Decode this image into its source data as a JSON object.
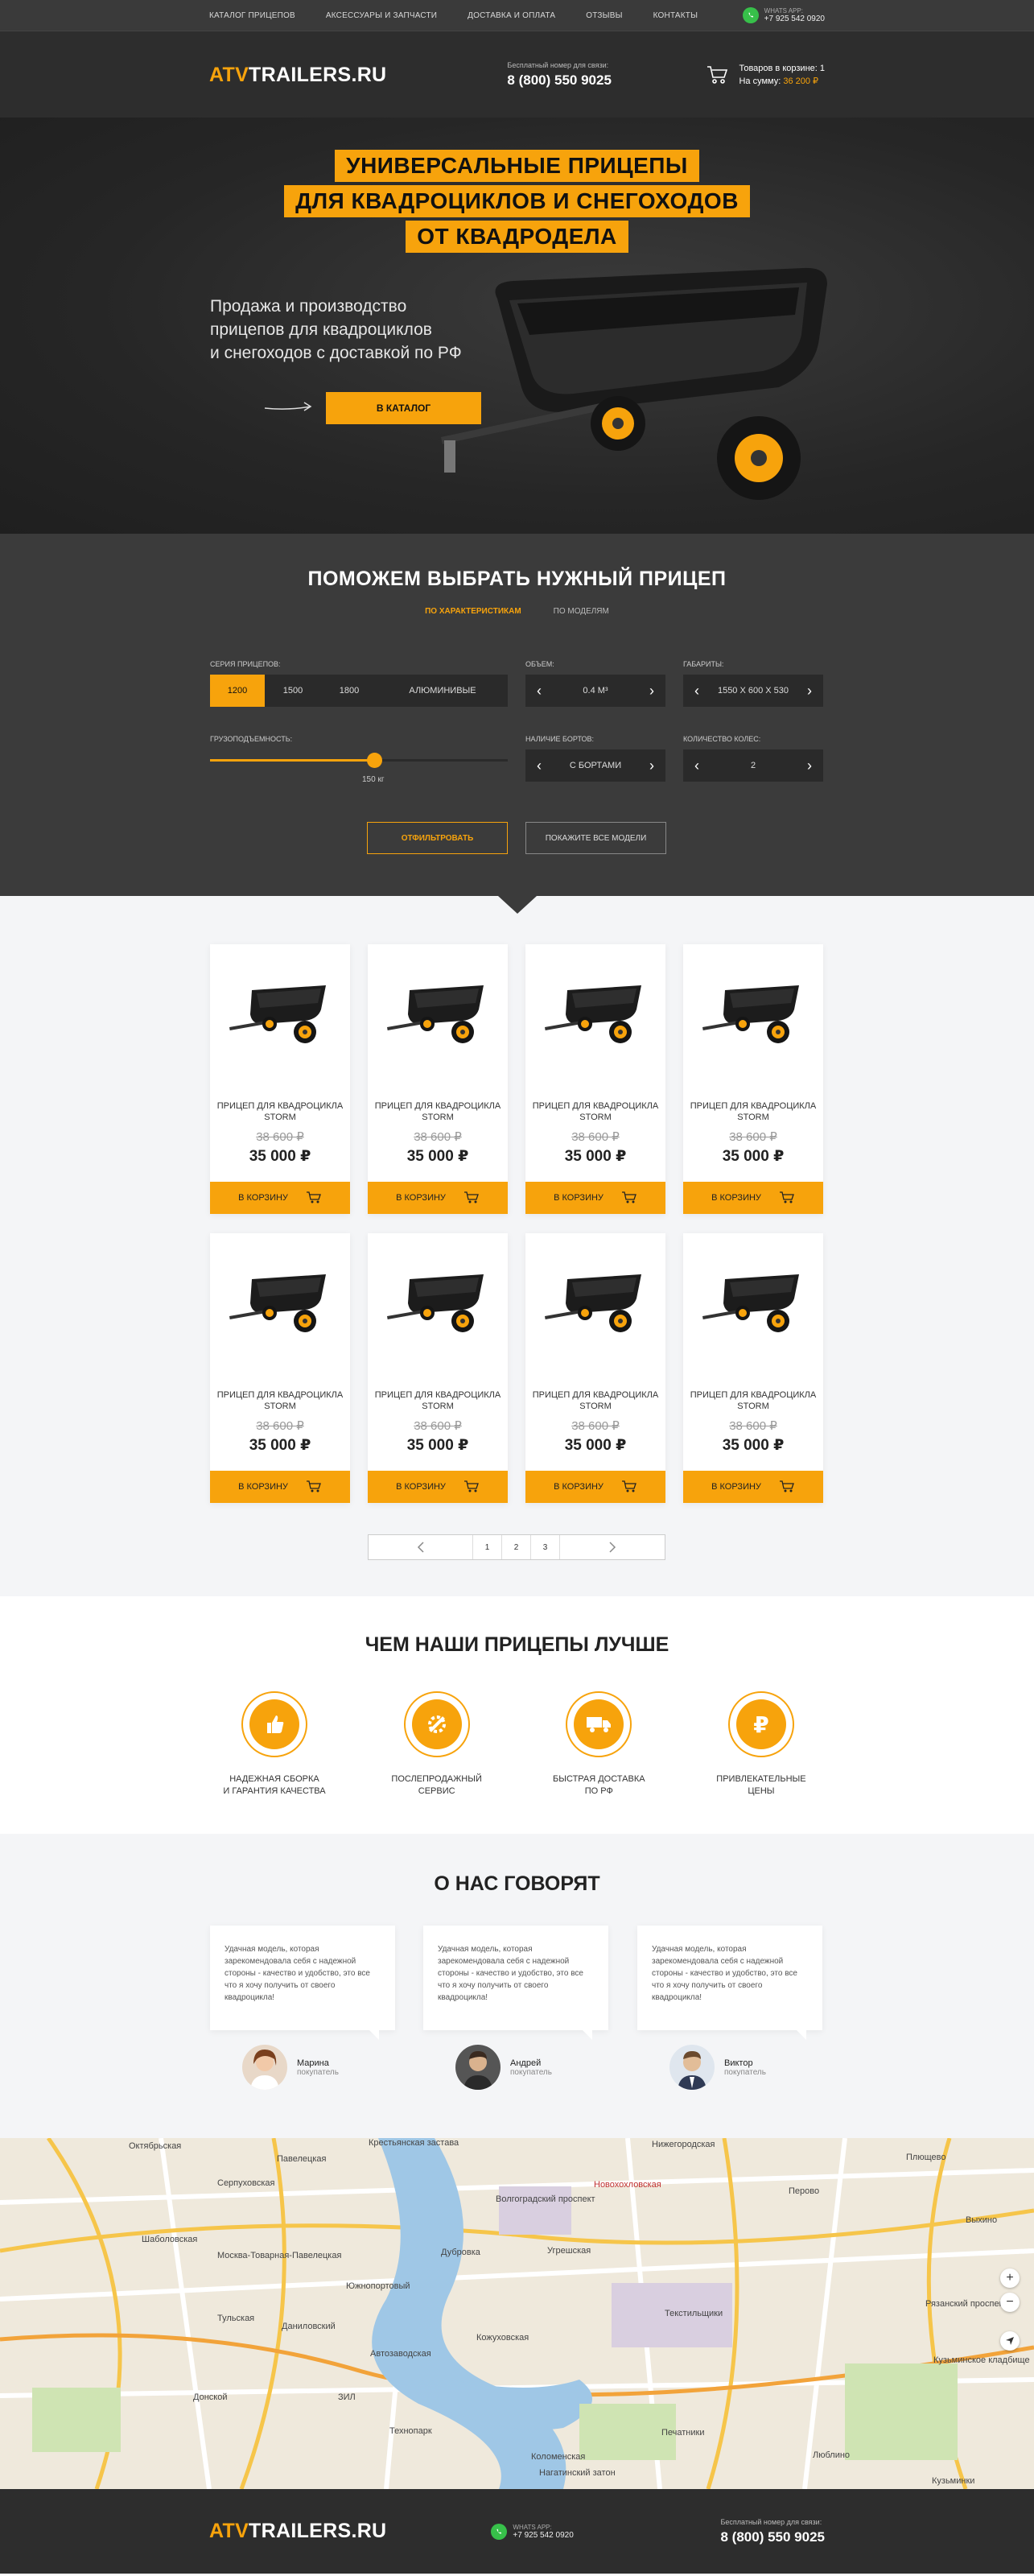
{
  "topnav": {
    "items": [
      "Каталог прицепов",
      "Аксессуары и запчасти",
      "Доставка и оплата",
      "Отзывы",
      "Контакты"
    ],
    "whatsapp_label": "WHATS APP:",
    "whatsapp_phone": "+7 925 542 0920"
  },
  "header": {
    "logo_atv": "ATV",
    "logo_rest": "TRAILERS.RU",
    "phone_caption": "Бесплатный номер для связи:",
    "phone": "8 (800) 550 9025",
    "cart_count_label": "Товаров в корзине: 1",
    "cart_sum_label": "На сумму:",
    "cart_sum_value": "36 200 ₽"
  },
  "hero": {
    "headline": [
      "УНИВЕРСАЛЬНЫЕ ПРИЦЕПЫ",
      "ДЛЯ КВАДРОЦИКЛОВ И СНЕГОХОДОВ",
      "ОТ КВАДРОДЕЛА"
    ],
    "subtitle": [
      "Продажа и производство",
      "прицепов для квадроциклов",
      "и снегоходов с доставкой по РФ"
    ],
    "button": "В КАТАЛОГ"
  },
  "filter": {
    "title": "ПОМОЖЕМ ВЫБРАТЬ НУЖНЫЙ ПРИЦЕП",
    "tab_active": "ПО ХАРАКТЕРИСТИКАМ",
    "tab_inactive": "ПО МОДЕЛЯМ",
    "series_label": "Серия прицепов:",
    "series_options": [
      "1200",
      "1500",
      "1800",
      "АЛЮМИНИВЫЕ"
    ],
    "volume_label": "Объем:",
    "volume_value": "0.4 М³",
    "size_label": "Габариты:",
    "size_value": "1550 X 600 X 530",
    "load_label": "Грузоподъемность:",
    "load_value": "150 кг",
    "load_level": 0.55,
    "sides_label": "Наличие бортов:",
    "sides_value": "С БОРТАМИ",
    "wheels_label": "Количество колес:",
    "wheels_value": "2",
    "btn_filter": "ОТФИЛЬТРОВАТЬ",
    "btn_all": "ПОКАЖИТЕ ВСЕ МОДЕЛИ"
  },
  "catalog": {
    "products": [
      {
        "name": "ПРИЦЕП ДЛЯ КВАДРОЦИКЛА STORM",
        "old_price": "38 600 ₽",
        "price": "35 000 ₽",
        "buy": "В КОРЗИНУ"
      },
      {
        "name": "ПРИЦЕП ДЛЯ КВАДРОЦИКЛА STORM",
        "old_price": "38 600 ₽",
        "price": "35 000 ₽",
        "buy": "В КОРЗИНУ"
      },
      {
        "name": "ПРИЦЕП ДЛЯ КВАДРОЦИКЛА STORM",
        "old_price": "38 600 ₽",
        "price": "35 000 ₽",
        "buy": "В КОРЗИНУ"
      },
      {
        "name": "ПРИЦЕП ДЛЯ КВАДРОЦИКЛА STORM",
        "old_price": "38 600 ₽",
        "price": "35 000 ₽",
        "buy": "В КОРЗИНУ"
      },
      {
        "name": "ПРИЦЕП ДЛЯ КВАДРОЦИКЛА STORM",
        "old_price": "38 600 ₽",
        "price": "35 000 ₽",
        "buy": "В КОРЗИНУ"
      },
      {
        "name": "ПРИЦЕП ДЛЯ КВАДРОЦИКЛА STORM",
        "old_price": "38 600 ₽",
        "price": "35 000 ₽",
        "buy": "В КОРЗИНУ"
      },
      {
        "name": "ПРИЦЕП ДЛЯ КВАДРОЦИКЛА STORM",
        "old_price": "38 600 ₽",
        "price": "35 000 ₽",
        "buy": "В КОРЗИНУ"
      },
      {
        "name": "ПРИЦЕП ДЛЯ КВАДРОЦИКЛА STORM",
        "old_price": "38 600 ₽",
        "price": "35 000 ₽",
        "buy": "В КОРЗИНУ"
      }
    ],
    "pages": [
      "1",
      "2",
      "3"
    ]
  },
  "advantages": {
    "title": "ЧЕМ НАШИ ПРИЦЕПЫ ЛУЧШЕ",
    "items": [
      {
        "icon": "thumbs-up-icon",
        "text": [
          "НАДЕЖНАЯ СБОРКА",
          "И ГАРАНТИЯ КАЧЕСТВА"
        ]
      },
      {
        "icon": "wrench-gear-icon",
        "text": [
          "ПОСЛЕПРОДАЖНЫЙ",
          "СЕРВИС"
        ]
      },
      {
        "icon": "delivery-truck-icon",
        "text": [
          "БЫСТРАЯ ДОСТАВКА",
          "ПО РФ"
        ]
      },
      {
        "icon": "ruble-icon",
        "text": [
          "ПРИВЛЕКАТЕЛЬНЫЕ",
          "ЦЕНЫ"
        ]
      }
    ]
  },
  "reviews": {
    "title": "О НАС ГОВОРЯТ",
    "items": [
      {
        "text": "Удачная модель, которая зарекомендовала себя с надежной стороны - качество и удобство, это все что я хочу получить от своего квадроцикла!",
        "name": "Марина",
        "role": "покупатель"
      },
      {
        "text": "Удачная модель, которая зарекомендовала себя с надежной стороны - качество и удобство, это все что я хочу получить от своего квадроцикла!",
        "name": "Андрей",
        "role": "покупатель"
      },
      {
        "text": "Удачная модель, которая зарекомендовала себя с надежной стороны - качество и удобство, это все что я хочу получить от своего квадроцикла!",
        "name": "Виктор",
        "role": "покупатель"
      }
    ]
  },
  "map": {
    "labels": [
      "Октябрьская",
      "Серпуховская",
      "Павелецкая",
      "Шаболовская",
      "Крестьянская застава",
      "Нижегородская",
      "Волгоградский проспект",
      "Новохохловская",
      "Угрешская",
      "Дубровка",
      "Кожуховская",
      "Автозаводская",
      "Технопарк",
      "Печатники",
      "Текстильщики",
      "Люблино",
      "Кузьминки",
      "Рязанский проспект",
      "Выхино",
      "Перово",
      "Плющево",
      "Коломенская",
      "Нагатинский затон",
      "Южнопортовый",
      "Даниловский",
      "Донской",
      "Москва-Товарная-Павелецкая",
      "Тульская",
      "ЗИЛ",
      "Кузьминское кладбище"
    ],
    "zoom_in": "+",
    "zoom_out": "−"
  },
  "footer": {
    "logo_atv": "ATV",
    "logo_rest": "TRAILERS.RU",
    "whatsapp_label": "WHATS APP:",
    "whatsapp_phone": "+7 925 542 0920",
    "phone_caption": "Бесплатный номер для связи:",
    "phone": "8 (800) 550 9025"
  },
  "colors": {
    "accent": "#f7a30c",
    "dark": "#2d2d2d",
    "filter_bg": "#3b3b3b",
    "light_bg": "#f4f5f7",
    "whatsapp": "#37c04a"
  }
}
